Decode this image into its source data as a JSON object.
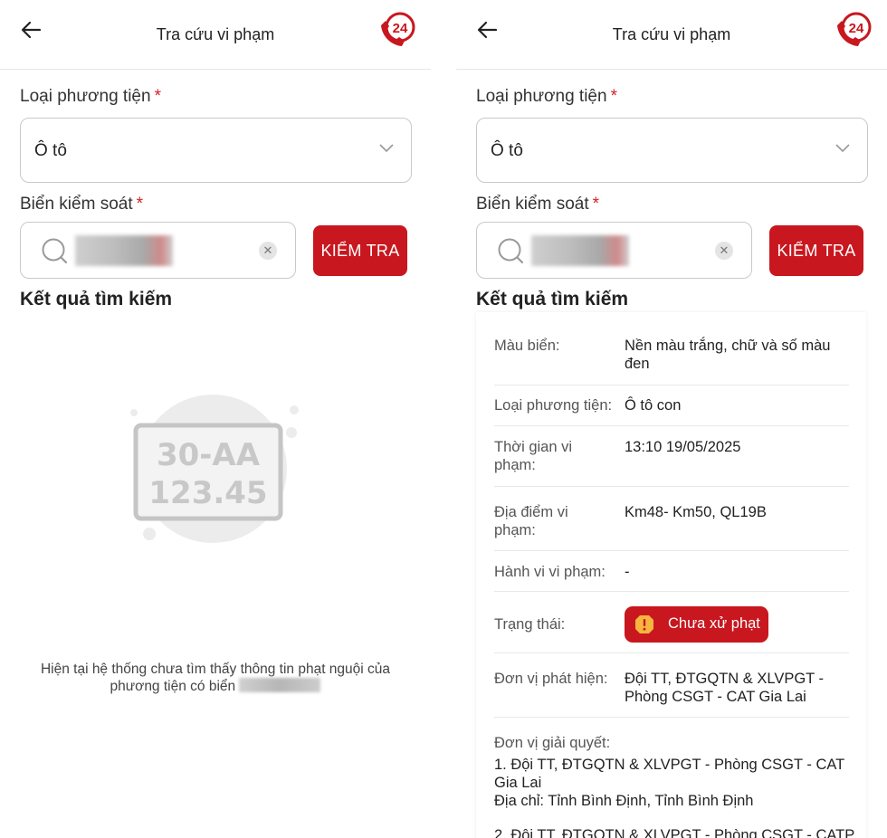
{
  "left": {
    "title": "Tra cứu vi phạm",
    "vehicle_label": "Loại phương tiện",
    "plate_label": "Biển kiểm soát",
    "required_mark": "*",
    "vehicle_value": "Ô tô",
    "check_button": "KIỂM TRA",
    "results_title": "Kết quả tìm kiếm",
    "illustration_line1": "30-AA",
    "illustration_line2": "123.45",
    "empty_message_line1": "Hiện tại hệ thống chưa tìm thấy thông tin phạt nguội của",
    "empty_message_line2": "phương tiện có biển",
    "hotline_badge": "24"
  },
  "right": {
    "title": "Tra cứu vi phạm",
    "vehicle_label": "Loại phương tiện",
    "plate_label": "Biển kiểm soát",
    "required_mark": "*",
    "vehicle_value": "Ô tô",
    "check_button": "KIỂM TRA",
    "results_title": "Kết quả tìm kiếm",
    "hotline_badge": "24",
    "details": {
      "plate_color_label": "Màu biển:",
      "plate_color_value": "Nền màu trắng, chữ và số màu đen",
      "vehicle_type_label": "Loại phương tiện:",
      "vehicle_type_value": "Ô tô con",
      "time_label": "Thời gian vi phạm:",
      "time_value": "13:10 19/05/2025",
      "place_label": "Địa điểm vi phạm:",
      "place_value": "Km48- Km50, QL19B",
      "behavior_label": "Hành vi vi phạm:",
      "behavior_value": "-",
      "status_label": "Trạng thái:",
      "status_value": "Chưa xử phạt",
      "detector_label": "Đơn vị phát hiện:",
      "detector_value": "Đội TT, ĐTGQTN & XLVPGT - Phòng CSGT - CAT Gia Lai",
      "resolver_label": "Đơn vị giải quyết:",
      "resolver_1": "1. Đội TT, ĐTGQTN & XLVPGT - Phòng CSGT - CAT Gia Lai",
      "resolver_1_address": "Địa chỉ: Tỉnh Bình Định, Tỉnh Bình Định",
      "resolver_2": "2. Đội TT, ĐTGQTN & XLVPGT - Phòng CSGT - CATP"
    }
  },
  "colors": {
    "brand_red": "#c8171e",
    "border": "#c9c9c9",
    "divider": "#e8e8e8"
  },
  "icons": [
    "back-arrow-icon",
    "hotline-24-icon",
    "chevron-down-icon",
    "search-icon",
    "clear-icon",
    "warning-icon"
  ]
}
